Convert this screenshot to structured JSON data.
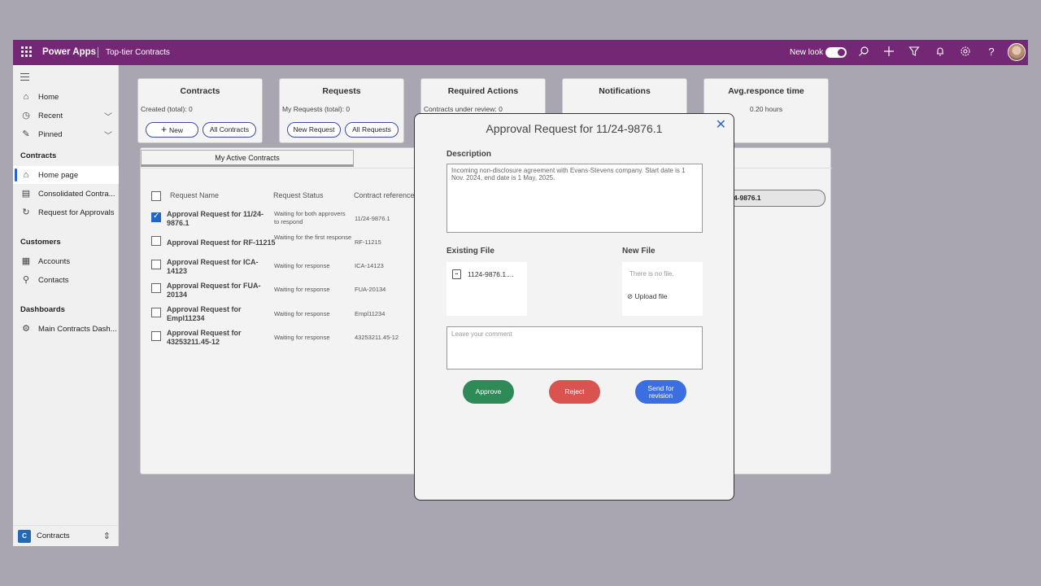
{
  "topbar": {
    "app_name": "Power Apps",
    "env_name": "Top-tier Contracts",
    "new_look_label": "New look",
    "new_look_on": true,
    "icons": [
      "search-icon",
      "add-icon",
      "filter-icon",
      "bell-icon",
      "settings-icon",
      "help-icon"
    ],
    "brand_color": "#742774"
  },
  "sidebar": {
    "items_top": [
      {
        "label": "Home",
        "icon": "home-icon"
      },
      {
        "label": "Recent",
        "icon": "clock-icon"
      },
      {
        "label": "Pinned",
        "icon": "pin-icon"
      }
    ],
    "section_contracts": "Contracts",
    "contracts_items": [
      {
        "label": "Home page",
        "icon": "home-icon",
        "active": true
      },
      {
        "label": "Consolidated Contra...",
        "icon": "document-icon"
      },
      {
        "label": "Request for Approvals",
        "icon": "approval-icon"
      }
    ],
    "section_customers": "Customers",
    "customers_items": [
      {
        "label": "Accounts",
        "icon": "building-icon"
      },
      {
        "label": "Contacts",
        "icon": "person-icon"
      }
    ],
    "section_dashboards": "Dashboards",
    "dashboards_items": [
      {
        "label": "Main Contracts Dash...",
        "icon": "dashboard-icon"
      }
    ],
    "footer": {
      "badge": "C",
      "label": "Contracts"
    }
  },
  "cards": {
    "contracts": {
      "title": "Contracts",
      "subtitle": "Created (total): 0",
      "new_btn": "New",
      "all_btn": "All Contracts"
    },
    "requests": {
      "title": "Requests",
      "subtitle": "My Requests (total): 0",
      "new_btn": "New Request",
      "all_btn": "All Requests"
    },
    "actions": {
      "title": "Required Actions",
      "subtitle": "Contracts under review: 0"
    },
    "notifications": {
      "title": "Notifications"
    },
    "avg": {
      "title": "Avg.responce time",
      "subtitle": "0.20 hours"
    }
  },
  "list": {
    "tab_label": "My Active Contracts",
    "headers": {
      "name": "Request Name",
      "status": "Request Status",
      "ref": "Contract reference"
    },
    "rows": [
      {
        "name": "Approval Request for 11/24-9876.1",
        "status": "Waiting for both approvers to respond",
        "ref": "11/24-9876.1",
        "checked": true
      },
      {
        "name": "Approval Request for RF-11215",
        "status": "Waiting for the first response",
        "ref": "RF-11215",
        "checked": false
      },
      {
        "name": "Approval Request for ICA-14123",
        "status": "Waiting for response",
        "ref": "ICA-14123",
        "checked": false
      },
      {
        "name": "Approval Request for FUA-20134",
        "status": "Waiting for response",
        "ref": "FUA-20134",
        "checked": false
      },
      {
        "name": "Approval Request for Empl11234",
        "status": "Waiting for response",
        "ref": "Empl11234",
        "checked": false
      },
      {
        "name": "Approval Request for 43253211.45-12",
        "status": "Waiting for response",
        "ref": "43253211.45-12",
        "checked": false
      }
    ],
    "right_pill": "4-9876.1"
  },
  "modal": {
    "title": "Approval Request for 11/24-9876.1",
    "description_label": "Description",
    "description": "Incoming non-disclosure agreement with Evans-Stevens company. Start date is 1 Nov. 2024, end date is 1 May, 2025.",
    "existing_file_label": "Existing File",
    "existing_file_name": "1124-9876.1....",
    "new_file_label": "New File",
    "no_file_text": "There is no file.",
    "upload_label": "Upload file",
    "comment_placeholder": "Leave your comment",
    "approve_label": "Approve",
    "reject_label": "Reject",
    "revision_label": "Send for revision",
    "colors": {
      "approve": "#2e8b57",
      "reject": "#d9534f",
      "revision": "#3b6ee0"
    }
  }
}
